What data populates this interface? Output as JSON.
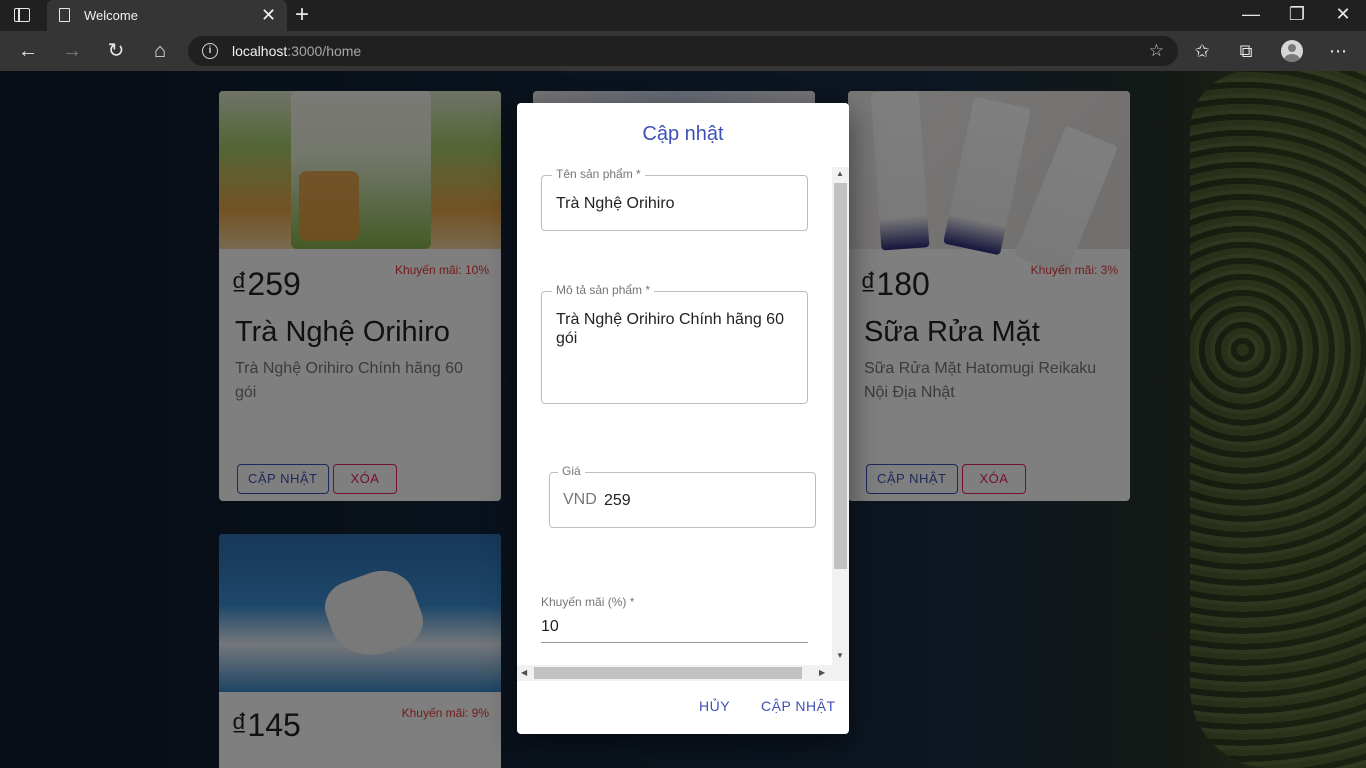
{
  "browser": {
    "tab_title": "Welcome",
    "tab_close": "✕",
    "new_tab": "+",
    "url_host": "localhost",
    "url_path": ":3000/home",
    "window_controls": {
      "minimize": "—",
      "restore": "❐",
      "close": "✕"
    },
    "icons": [
      "back-icon",
      "forward-icon",
      "refresh-icon",
      "home-icon",
      "site-info-icon",
      "add-favorite-icon",
      "favorites-icon",
      "collections-icon",
      "profile-icon",
      "more-icon"
    ]
  },
  "products": [
    {
      "price": "₫259",
      "discount": "Khuyến mãi: 10%",
      "name": "Trà Nghệ Orihiro",
      "description": "Trà Nghệ Orihiro Chính hãng 60 gói",
      "update_label": "CẬP NHẬT",
      "delete_label": "XÓA",
      "image_color": "#8bbf5a"
    },
    {
      "price": "₫180",
      "discount": "Khuyến mãi: 3%",
      "name": "Sữa Rửa Mặt",
      "description": "Sữa Rửa Mặt Hatomugi Reikaku Nội Địa Nhật",
      "update_label": "CẬP NHẬT",
      "delete_label": "XÓA",
      "image_color": "#e6e3e1"
    },
    {
      "price": "₫145",
      "discount": "Khuyến mãi: 9%",
      "image_color": "#3a88c8"
    }
  ],
  "dialog": {
    "title": "Cập nhật",
    "name_label": "Tên sản phẩm *",
    "name_value": "Trà Nghệ Orihiro",
    "description_label": "Mô tả sản phẩm *",
    "description_value": "Trà Nghệ Orihiro Chính hãng 60 gói",
    "price_label": "Giá",
    "price_currency": "VND",
    "price_value": "259",
    "discount_label": "Khuyến mãi (%) *",
    "discount_value": "10",
    "cancel_label": "HỦY",
    "submit_label": "CẬP NHẬT"
  },
  "colors": {
    "primary": "#3f51b5",
    "danger": "#e91e63",
    "discount_text": "#e53935"
  }
}
